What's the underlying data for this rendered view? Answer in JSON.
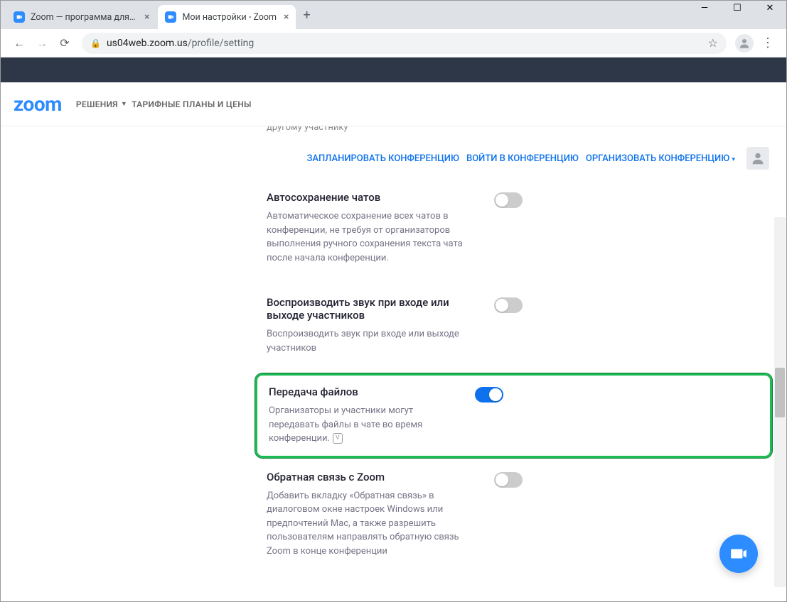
{
  "browser": {
    "tabs": [
      {
        "title": "Zoom — программа для конфе",
        "active": false
      },
      {
        "title": "Мои настройки - Zoom",
        "active": true
      }
    ],
    "url_prefix": "us04web.zoom.us",
    "url_path": "/profile/setting"
  },
  "header": {
    "logo": "zoom",
    "nav": [
      {
        "label": "РЕШЕНИЯ",
        "has_dropdown": true
      },
      {
        "label": "ТАРИФНЫЕ ПЛАНЫ И ЦЕНЫ",
        "has_dropdown": false
      }
    ],
    "partial_text": "другому участнику"
  },
  "actions": {
    "schedule": "ЗАПЛАНИРОВАТЬ КОНФЕРЕНЦИЮ",
    "join": "ВОЙТИ В КОНФЕРЕНЦИЮ",
    "host": "ОРГАНИЗОВАТЬ КОНФЕРЕНЦИЮ"
  },
  "settings": [
    {
      "title": "Автосохранение чатов",
      "desc": "Автоматическое сохранение всех чатов в конференции, не требуя от организаторов выполнения ручного сохранения текста чата после начала конференции.",
      "enabled": false,
      "highlighted": false
    },
    {
      "title": "Воспроизводить звук при входе или выходе участников",
      "desc": "Воспроизводить звук при входе или выходе участников",
      "enabled": false,
      "highlighted": false
    },
    {
      "title": "Передача файлов",
      "desc": "Организаторы и участники могут передавать файлы в чате во время конференции.",
      "enabled": true,
      "highlighted": true,
      "badge": "V"
    },
    {
      "title": "Обратная связь с Zoom",
      "desc": "Добавить вкладку «Обратная связь» в диалоговом окне настроек Windows или предпочтений Mac, а также разрешить пользователям направлять обратную связь Zoom в конце конференции",
      "enabled": false,
      "highlighted": false
    }
  ]
}
